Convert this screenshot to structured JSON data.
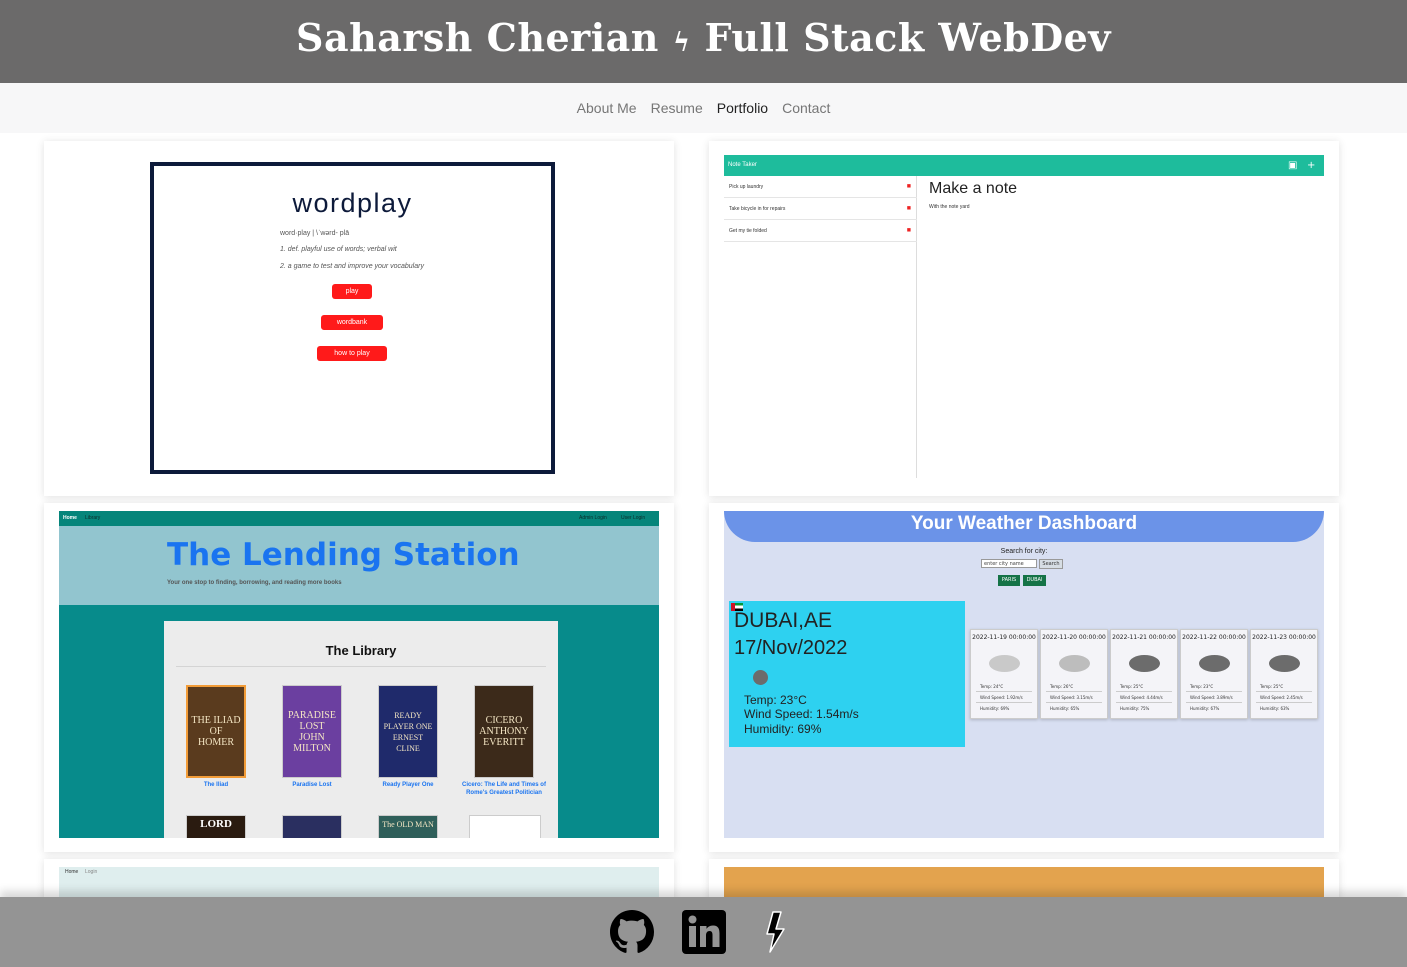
{
  "header": {
    "title_left": "Saharsh Cherian",
    "bolt": "ϟ",
    "title_right": "Full Stack WebDev"
  },
  "nav": {
    "items": [
      "About Me",
      "Resume",
      "Portfolio",
      "Contact"
    ],
    "active": "Portfolio"
  },
  "portfolio": {
    "wordplay": {
      "title": "wordplay",
      "pronunciation": "word·play | \\ˈwərd- plā",
      "def1": "1. def. playful use of words; verbal wit",
      "def2": "2. a game to test and improve your vocabulary",
      "buttons": [
        "play",
        "wordbank",
        "how to play"
      ]
    },
    "note_taker": {
      "app_name": "Note Taker",
      "notes": [
        "Pick up laundry",
        "Take bicycle in for repairs",
        "Get my tie folded"
      ],
      "heading": "Make a note",
      "body": "With the note yard"
    },
    "lending_station": {
      "nav_left": [
        "Home",
        "Library"
      ],
      "nav_right": [
        "Admin Login",
        "User Login"
      ],
      "title": "The Lending Station",
      "tagline": "Your one stop to finding, borrowing, and reading more books",
      "library_title": "The Library",
      "books": [
        {
          "cover": "THE ILIAD OF HOMER",
          "caption": "The Iliad"
        },
        {
          "cover": "PARADISE LOST JOHN MILTON",
          "caption": "Paradise Lost"
        },
        {
          "cover": "READY PLAYER ONE ERNEST CLINE",
          "caption": "Ready Player One"
        },
        {
          "cover": "CICERO ANTHONY EVERITT",
          "caption": "Cicero: The Life and Times of Rome's Greatest Politician"
        }
      ],
      "row2_covers": [
        "LORD",
        "",
        "The OLD MAN",
        ""
      ]
    },
    "weather": {
      "title": "Your Weather Dashboard",
      "search_label": "Search for city:",
      "search_placeholder": "enter city name",
      "search_button": "Search",
      "history": [
        "PARIS",
        "DUBAI"
      ],
      "city": "DUBAI,AE",
      "date": "17/Nov/2022",
      "temp": "Temp: 23°C",
      "wind": "Wind Speed: 1.54m/s",
      "humidity": "Humidity: 69%",
      "forecast": [
        {
          "date": "2022-11-19 00:00:00",
          "temp": "Temp: 24°C",
          "wind": "Wind Speed: 1.92m/s",
          "humidity": "Humidity: 69%"
        },
        {
          "date": "2022-11-20 00:00:00",
          "temp": "Temp: 26°C",
          "wind": "Wind Speed: 3.15m/s",
          "humidity": "Humidity: 65%"
        },
        {
          "date": "2022-11-21 00:00:00",
          "temp": "Temp: 25°C",
          "wind": "Wind Speed: 4.44m/s",
          "humidity": "Humidity: 75%"
        },
        {
          "date": "2022-11-22 00:00:00",
          "temp": "Temp: 23°C",
          "wind": "Wind Speed: 3.89m/s",
          "humidity": "Humidity: 67%"
        },
        {
          "date": "2022-11-23 00:00:00",
          "temp": "Temp: 25°C",
          "wind": "Wind Speed: 2.45m/s",
          "humidity": "Humidity: 63%"
        }
      ]
    },
    "row3_left_nav": [
      "Home",
      "Login"
    ]
  },
  "footer": {
    "icons": [
      "github-icon",
      "linkedin-icon",
      "bolt-icon"
    ]
  },
  "colors": {
    "header_bg": "#6b6a6a",
    "nav_bg": "#f7f7f8",
    "footer_bg": "#949494",
    "wordplay_red": "#ff1a1a",
    "notetaker_teal": "#1ebc9c",
    "lending_blue": "#1a74f0",
    "weather_blue": "#6b93e8",
    "weather_cyan": "#2ed1f0"
  }
}
